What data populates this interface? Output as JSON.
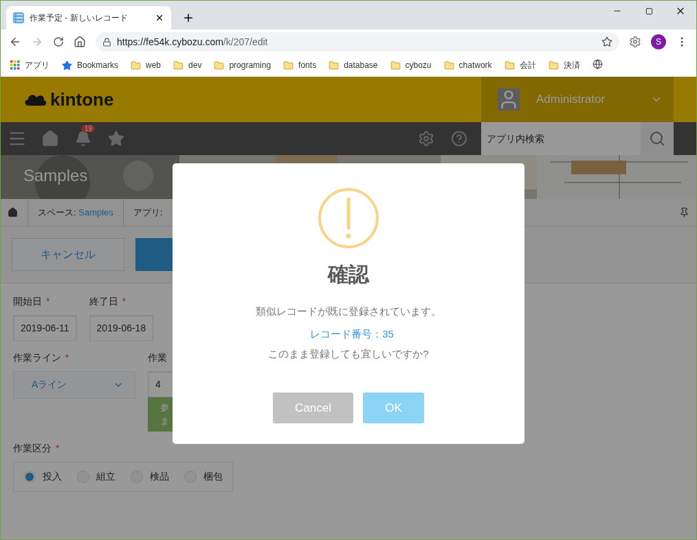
{
  "browser": {
    "tab": {
      "title": "作業予定 - 新しいレコード"
    },
    "url": {
      "host": "https://fe54k.cybozu.com",
      "path": "/k/207/edit"
    },
    "profile": "S",
    "bookmarks": [
      {
        "kind": "apps",
        "label": "アプリ"
      },
      {
        "kind": "star",
        "label": "Bookmarks"
      },
      {
        "kind": "folder",
        "label": "web"
      },
      {
        "kind": "folder",
        "label": "dev"
      },
      {
        "kind": "folder",
        "label": "programing"
      },
      {
        "kind": "folder",
        "label": "fonts"
      },
      {
        "kind": "folder",
        "label": "database"
      },
      {
        "kind": "folder",
        "label": "cybozu"
      },
      {
        "kind": "folder",
        "label": "chatwork"
      },
      {
        "kind": "folder",
        "label": "会計"
      },
      {
        "kind": "folder",
        "label": "決済"
      },
      {
        "kind": "globe"
      }
    ]
  },
  "app": {
    "logo": "kintone",
    "user": "Administrator",
    "notification_count": "19",
    "search": {
      "placeholder": "アプリ内検索"
    },
    "banner_title": "Samples",
    "breadcrumb": [
      {
        "prefix": "スペース: ",
        "link": "Samples"
      },
      {
        "prefix": "アプリ:"
      }
    ],
    "toolbar": {
      "cancel": "キャンセル"
    },
    "form": {
      "rows": [
        [
          {
            "kind": "date",
            "label": "開始日",
            "mark": "*",
            "value": "2019-06-11"
          },
          {
            "kind": "date",
            "label": "終了日",
            "mark": "*",
            "value": "2019-06-18"
          }
        ],
        [
          {
            "kind": "select",
            "label": "作業ライン",
            "mark": "*",
            "value": "Aライン"
          },
          {
            "kind": "lookup",
            "label": "作業",
            "value": "4",
            "button_lines": [
              "参",
              "ま"
            ]
          }
        ],
        [
          {
            "kind": "radio",
            "label": "作業区分",
            "mark": "*",
            "options": [
              {
                "label": "投入",
                "selected": true
              },
              {
                "label": "組立",
                "selected": false
              },
              {
                "label": "検品",
                "selected": false
              },
              {
                "label": "梱包",
                "selected": false
              }
            ]
          }
        ]
      ]
    }
  },
  "dialog": {
    "title": "確認",
    "message": "類似レコードが既に登録されています。",
    "record_link": "レコード番号：35",
    "question": "このまま登録しても宜しいですか?",
    "buttons": [
      {
        "kind": "cancel",
        "label": "Cancel"
      },
      {
        "kind": "ok",
        "label": "OK"
      }
    ]
  }
}
